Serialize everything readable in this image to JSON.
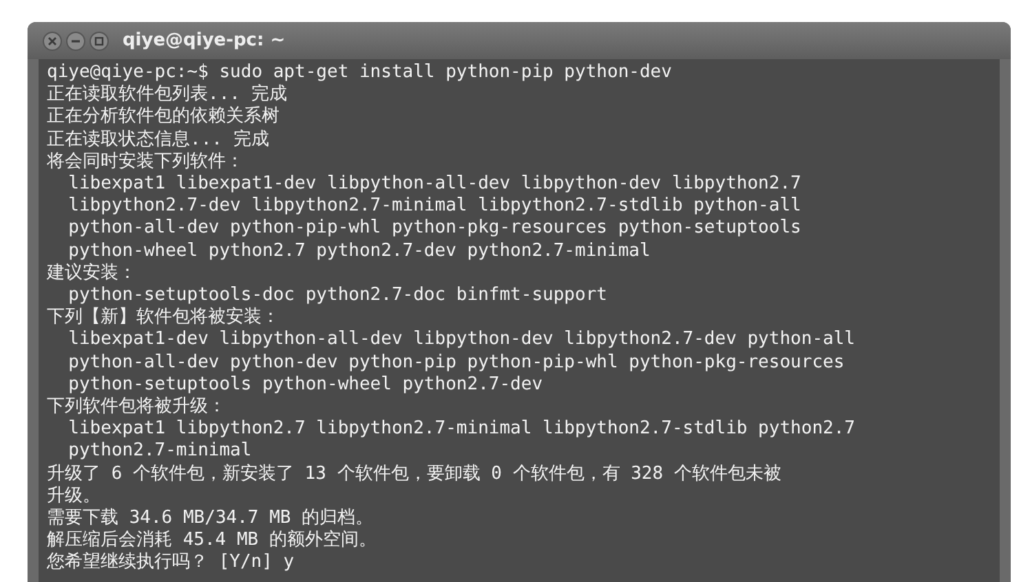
{
  "window": {
    "title": "qiye@qiye-pc: ~"
  },
  "terminal": {
    "lines": [
      "qiye@qiye-pc:~$ sudo apt-get install python-pip python-dev",
      "正在读取软件包列表... 完成",
      "正在分析软件包的依赖关系树",
      "正在读取状态信息... 完成",
      "将会同时安装下列软件：",
      "  libexpat1 libexpat1-dev libpython-all-dev libpython-dev libpython2.7",
      "  libpython2.7-dev libpython2.7-minimal libpython2.7-stdlib python-all",
      "  python-all-dev python-pip-whl python-pkg-resources python-setuptools",
      "  python-wheel python2.7 python2.7-dev python2.7-minimal",
      "建议安装：",
      "  python-setuptools-doc python2.7-doc binfmt-support",
      "下列【新】软件包将被安装：",
      "  libexpat1-dev libpython-all-dev libpython-dev libpython2.7-dev python-all",
      "  python-all-dev python-dev python-pip python-pip-whl python-pkg-resources",
      "  python-setuptools python-wheel python2.7-dev",
      "下列软件包将被升级：",
      "  libexpat1 libpython2.7 libpython2.7-minimal libpython2.7-stdlib python2.7",
      "  python2.7-minimal",
      "升级了 6 个软件包，新安装了 13 个软件包，要卸载 0 个软件包，有 328 个软件包未被",
      "升级。",
      "需要下载 34.6 MB/34.7 MB 的归档。",
      "解压缩后会消耗 45.4 MB 的额外空间。",
      "您希望继续执行吗？ [Y/n] y"
    ]
  }
}
